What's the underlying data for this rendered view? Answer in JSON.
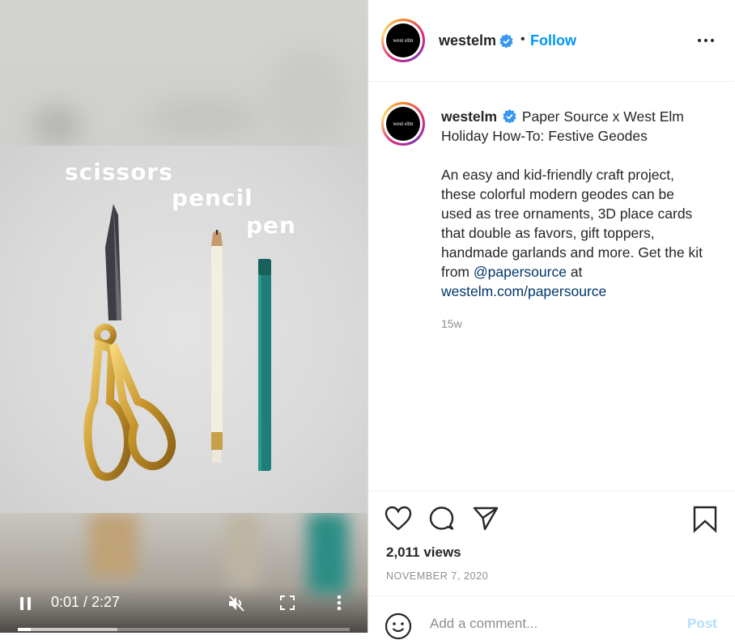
{
  "video": {
    "overlay_words": [
      "scissors",
      "pencil",
      "pen"
    ],
    "time_display": "0:01 / 2:27",
    "progress_fraction": 0.01,
    "buffer_fraction": 0.3,
    "controls": {
      "pause_icon": "pause-icon",
      "mute_icon": "muted-speaker-icon",
      "fullscreen_icon": "fullscreen-icon",
      "more_icon": "vertical-dots-icon"
    }
  },
  "post": {
    "account": {
      "username": "westelm",
      "avatar_text": "west elm",
      "verified": true
    },
    "follow_label": "Follow",
    "separator": "•",
    "caption": {
      "username": "westelm",
      "title": "Paper Source x West Elm Holiday How-To: Festive Geodes",
      "body": "An easy and kid-friendly craft project, these colorful modern geodes can be used as tree ornaments, 3D place cards that double as favors, gift toppers, handmade garlands and more. Get the kit from",
      "mention": "@papersource",
      "connector": "at",
      "link": "westelm.com/papersource"
    },
    "age": "15w",
    "views": "2,011 views",
    "date": "NOVEMBER 7, 2020",
    "comment_placeholder": "Add a comment...",
    "post_button": "Post"
  },
  "colors": {
    "follow": "#0095f6",
    "link": "#00376b",
    "verified": "#3897f0",
    "post_disabled": "#b2dffc",
    "muted_text": "#8e8e8e"
  }
}
